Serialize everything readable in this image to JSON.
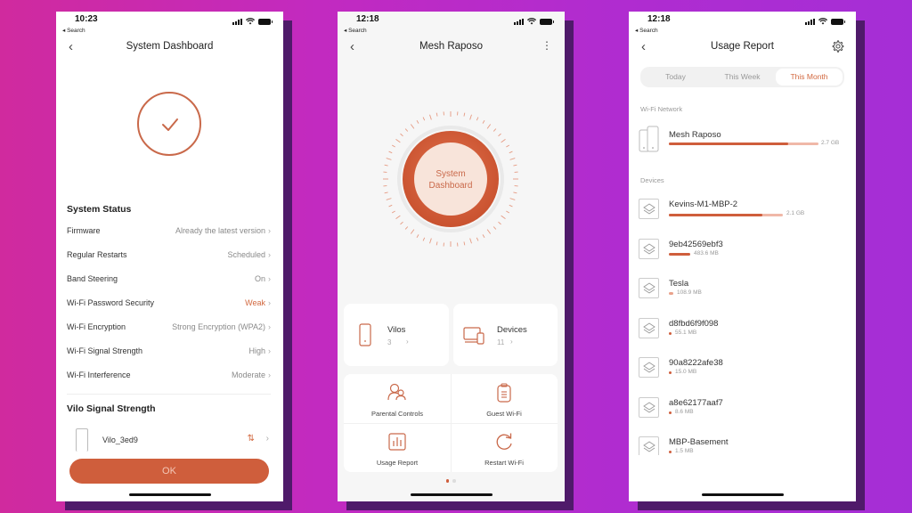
{
  "colors": {
    "accent": "#cf5e3c",
    "accent_light": "#f0b8a8",
    "warning_text": "#d2683f",
    "bg_gradient_start": "#d02a9e",
    "bg_gradient_end": "#a52ed6",
    "shadow": "#4f1a6a"
  },
  "screens": [
    {
      "status": {
        "time": "10:23",
        "back_app": "◂ Search"
      },
      "nav": {
        "back_icon": "‹",
        "title": "System Dashboard"
      },
      "hero_icon": "check-circle-icon",
      "system_status": {
        "title": "System Status",
        "rows": [
          {
            "label": "Firmware",
            "value": "Already the latest version",
            "highlight": false
          },
          {
            "label": "Regular Restarts",
            "value": "Scheduled",
            "highlight": false
          },
          {
            "label": "Band Steering",
            "value": "On",
            "highlight": false
          },
          {
            "label": "Wi-Fi Password Security",
            "value": "Weak",
            "highlight": true
          },
          {
            "label": "Wi-Fi Encryption",
            "value": "Strong Encryption (WPA2)",
            "highlight": false
          },
          {
            "label": "Wi-Fi Signal Strength",
            "value": "High",
            "highlight": false
          },
          {
            "label": "Wi-Fi Interference",
            "value": "Moderate",
            "highlight": false
          }
        ],
        "chevron": "›"
      },
      "vilo_signal": {
        "title": "Vilo Signal Strength",
        "items": [
          {
            "name": "Vilo_3ed9",
            "signal_glyph": "⇅"
          }
        ]
      },
      "ok_label": "OK"
    },
    {
      "status": {
        "time": "12:18",
        "back_app": "◂ Search"
      },
      "nav": {
        "back_icon": "‹",
        "title": "Mesh Raposo",
        "more_icon": "⋮"
      },
      "dial": {
        "line1": "System",
        "line2": "Dashboard"
      },
      "summary_cards": [
        {
          "title": "Vilos",
          "count": "3",
          "chevron": "›",
          "icon": "phone-device-icon"
        },
        {
          "title": "Devices",
          "count": "11",
          "chevron": "›",
          "icon": "devices-icon"
        }
      ],
      "actions": [
        {
          "label": "Parental Controls",
          "icon": "parental-controls-icon"
        },
        {
          "label": "Guest Wi-Fi",
          "icon": "guest-wifi-icon"
        },
        {
          "label": "Usage Report",
          "icon": "usage-report-icon"
        },
        {
          "label": "Restart Wi-Fi",
          "icon": "restart-icon"
        }
      ],
      "page_indicator": {
        "pages": 2,
        "active": 1
      }
    },
    {
      "status": {
        "time": "12:18",
        "back_app": "◂ Search"
      },
      "nav": {
        "back_icon": "‹",
        "title": "Usage Report",
        "settings_icon": "gear-icon"
      },
      "tabs": [
        {
          "label": "Today",
          "active": false
        },
        {
          "label": "This Week",
          "active": false
        },
        {
          "label": "This Month",
          "active": true
        }
      ],
      "wifi_network": {
        "label": "Wi-Fi Network",
        "name": "Mesh Raposo",
        "size": "2.7 GB",
        "fraction": 1.0
      },
      "devices": {
        "label": "Devices",
        "items": [
          {
            "name": "Kevins-M1-MBP-2",
            "size": "2.1 GB",
            "fraction": 0.78
          },
          {
            "name": "9eb42569ebf3",
            "size": "483.6 MB",
            "fraction": 0.18
          },
          {
            "name": "Tesla",
            "size": "108.9 MB",
            "fraction": 0.04
          },
          {
            "name": "d8fbd6f9f098",
            "size": "55.1 MB",
            "fraction": 0.02
          },
          {
            "name": "90a8222afe38",
            "size": "15.0 MB",
            "fraction": 0.006
          },
          {
            "name": "a8e62177aaf7",
            "size": "8.6 MB",
            "fraction": 0.003
          },
          {
            "name": "MBP-Basement",
            "size": "1.5 MB",
            "fraction": 0.001
          }
        ]
      }
    }
  ]
}
